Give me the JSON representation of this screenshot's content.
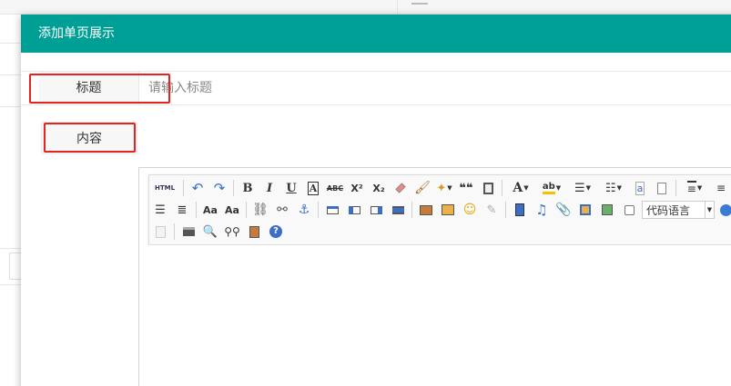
{
  "modal": {
    "title": "添加单页展示"
  },
  "form": {
    "title_label": "标题",
    "title_placeholder": "请输入标题",
    "title_value": "",
    "content_label": "内容"
  },
  "editor": {
    "html_button": "HTML",
    "bold": "B",
    "italic": "I",
    "underline": "U",
    "border_a": "A",
    "strike": "ABC",
    "superscript": "X²",
    "subscript": "X₂",
    "quote": "❝❝",
    "font_color": "A",
    "highlight": "ab",
    "code_language": "代码语言",
    "body_text": ""
  },
  "colors": {
    "header": "#009f95",
    "highlight_box": "#e8221f"
  }
}
